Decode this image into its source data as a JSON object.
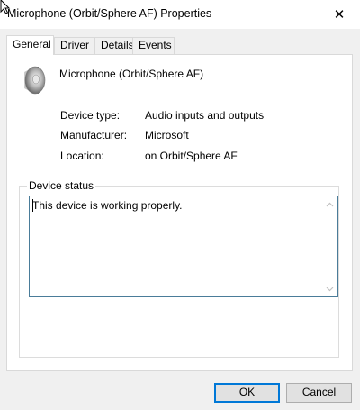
{
  "window": {
    "title": "Microphone (Orbit/Sphere AF) Properties",
    "close_glyph": "✕"
  },
  "tabs": [
    {
      "label": "General",
      "active": true
    },
    {
      "label": "Driver",
      "active": false
    },
    {
      "label": "Details",
      "active": false
    },
    {
      "label": "Events",
      "active": false
    }
  ],
  "device": {
    "name": "Microphone (Orbit/Sphere AF)",
    "icon": "speaker-icon",
    "properties": [
      {
        "label": "Device type:",
        "value": "Audio inputs and outputs"
      },
      {
        "label": "Manufacturer:",
        "value": "Microsoft"
      },
      {
        "label": "Location:",
        "value": "on Orbit/Sphere AF"
      }
    ]
  },
  "status": {
    "group_label": "Device status",
    "text": "This device is working properly."
  },
  "buttons": {
    "ok": "OK",
    "cancel": "Cancel"
  },
  "colors": {
    "focus_border": "#0078d7",
    "status_border": "#4a7c99"
  }
}
